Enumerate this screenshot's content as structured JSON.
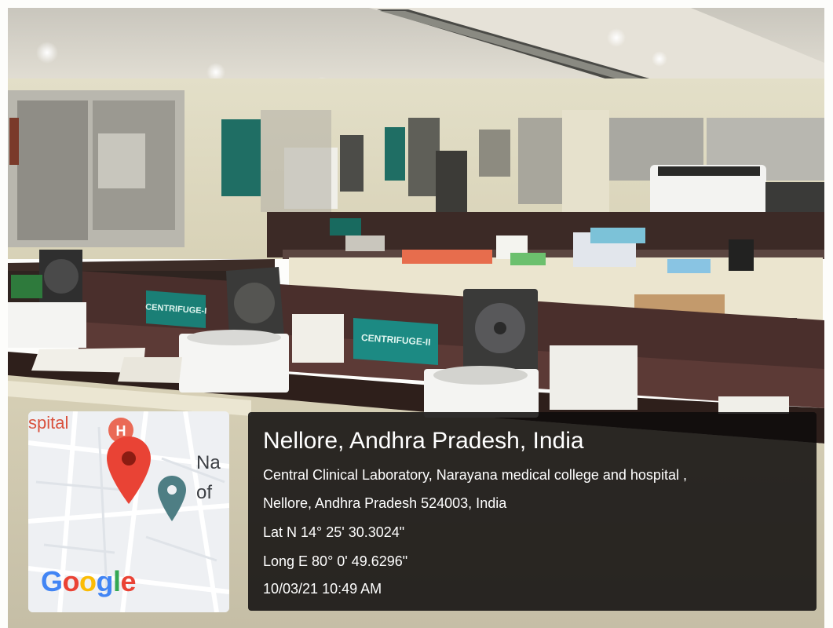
{
  "scene": {
    "signs": {
      "centrifuge_1": "CENTRIFUGE-I",
      "centrifuge_2": "CENTRIFUGE-II"
    }
  },
  "map": {
    "label_spital": "spital",
    "label_na": "Na",
    "label_of": "of",
    "logo": {
      "letters": [
        "G",
        "o",
        "o",
        "g",
        "l",
        "e"
      ],
      "colors": [
        "#4285F4",
        "#EA4335",
        "#FBBC05",
        "#4285F4",
        "#34A853",
        "#EA4335"
      ]
    },
    "pin_color": "#E94335",
    "secondary_pin_color": "#4E7E84",
    "hospital_marker_color": "#EA6A56"
  },
  "geotag": {
    "title": "Nellore, Andhra Pradesh, India",
    "address_line1": "Central Clinical Laboratory, Narayana medical college and hospital ,",
    "address_line2": "Nellore, Andhra Pradesh 524003, India",
    "latitude": "Lat N 14° 25' 30.3024\"",
    "longitude": "Long E 80° 0' 49.6296\"",
    "datetime": "10/03/21 10:49 AM"
  }
}
